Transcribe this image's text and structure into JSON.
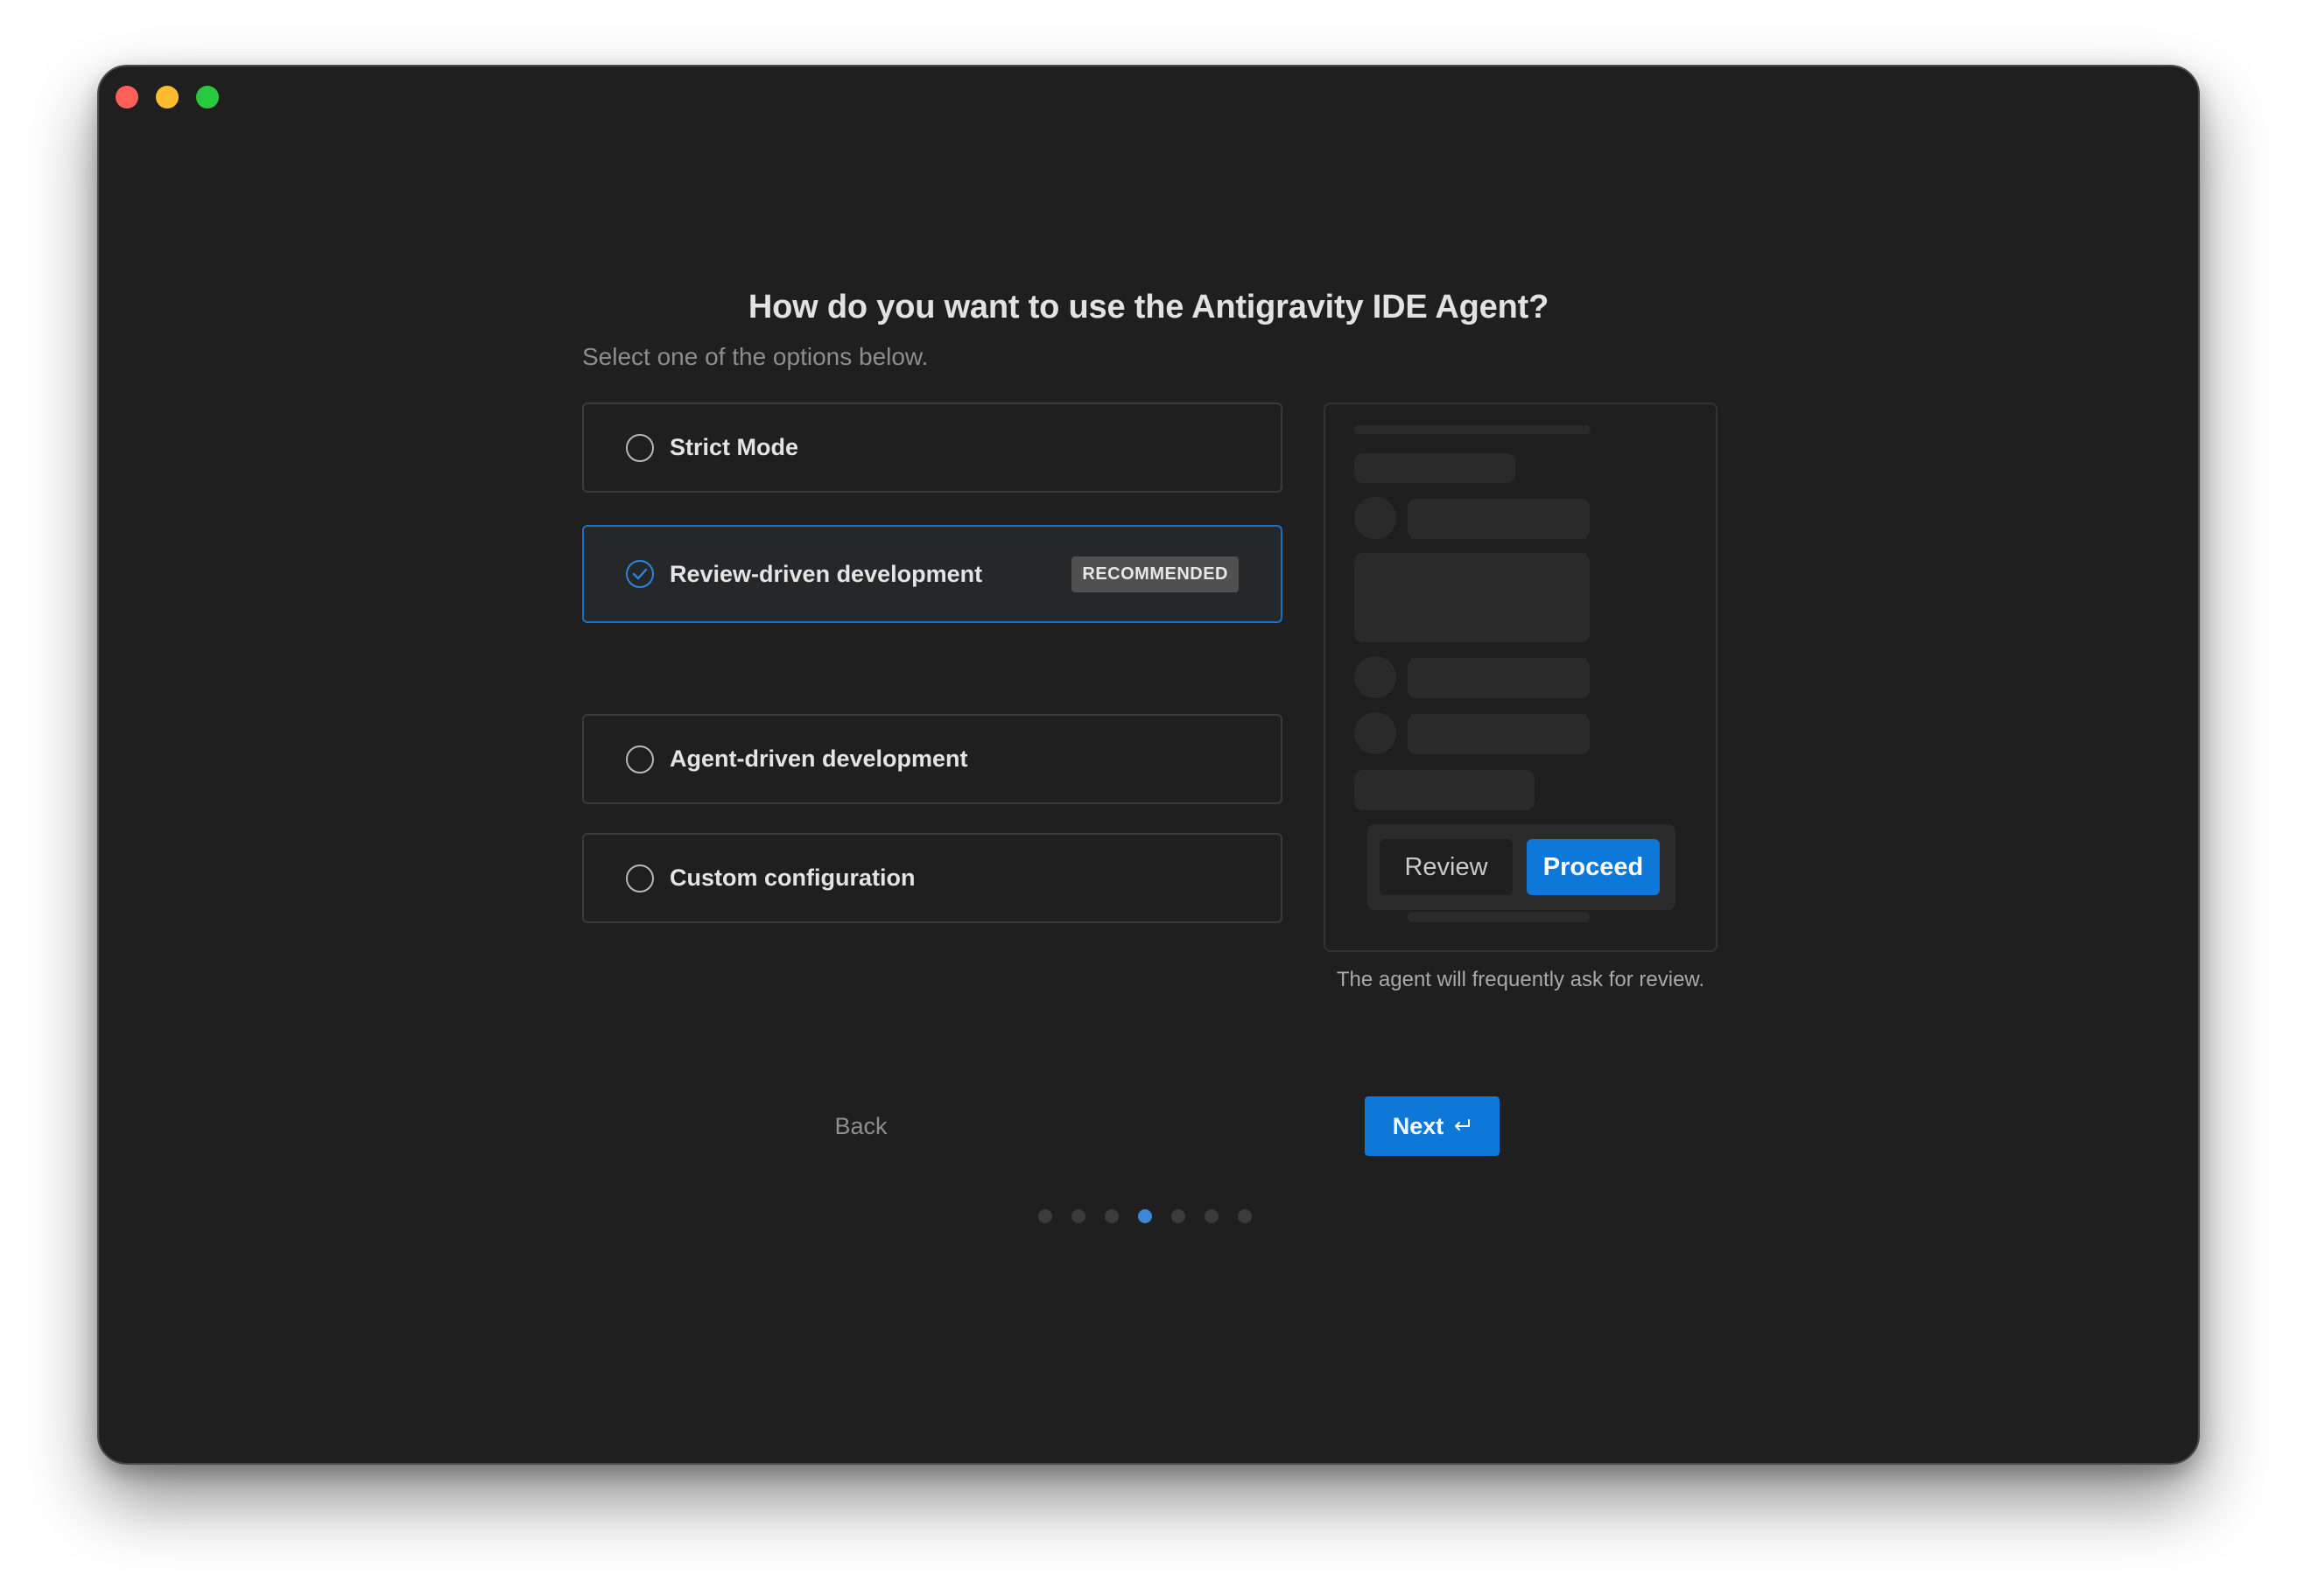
{
  "window": {
    "traffic_lights": [
      "close",
      "minimize",
      "zoom"
    ]
  },
  "page": {
    "title": "How do you want to use the Antigravity IDE Agent?",
    "subtitle": "Select one of the options below."
  },
  "options": [
    {
      "label": "Strict Mode",
      "selected": false,
      "badge": ""
    },
    {
      "label": "Review-driven development",
      "selected": true,
      "badge": "RECOMMENDED"
    },
    {
      "label": "Agent-driven development",
      "selected": false,
      "badge": ""
    },
    {
      "label": "Custom configuration",
      "selected": false,
      "badge": ""
    }
  ],
  "preview": {
    "review_label": "Review",
    "proceed_label": "Proceed",
    "caption": "The agent will frequently ask for review."
  },
  "nav": {
    "back_label": "Back",
    "next_label": "Next",
    "next_icon": "return-key-icon"
  },
  "pagination": {
    "total": 7,
    "current": 4
  },
  "colors": {
    "accent": "#0d78d8",
    "background": "#1f1f1f",
    "selected_border": "#1a6fc8",
    "traffic_red": "#fe5f57",
    "traffic_yellow": "#febc2e",
    "traffic_green": "#28c840"
  }
}
